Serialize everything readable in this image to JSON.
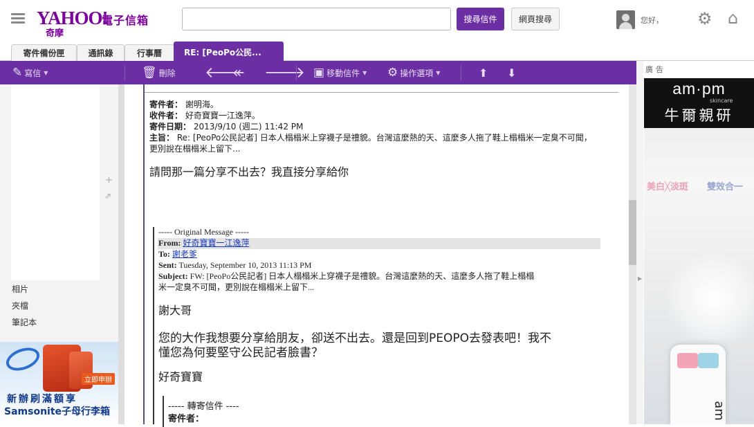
{
  "header": {
    "logo_text": "YAHOO!",
    "logo_sub": "奇摩",
    "mail_title": "電子信箱",
    "search_value": "",
    "search_mail_label": "搜尋信件",
    "search_web_label": "網頁搜尋",
    "greeting": "您好，"
  },
  "tabs": [
    {
      "label": "寄件備份匣"
    },
    {
      "label": "通訊錄"
    },
    {
      "label": "行事曆"
    },
    {
      "label": "RE: [PeoPo公民..."
    }
  ],
  "toolbar": {
    "compose": "寫信",
    "delete": "刪除",
    "move": "移動信件",
    "actions": "操作選項"
  },
  "sidebar": {
    "items": [
      {
        "label": "相片"
      },
      {
        "label": "夾檔"
      },
      {
        "label": "筆記本"
      }
    ],
    "ad": {
      "cta": "立即申辦",
      "line1": "新辦刷滿額享",
      "line2": "Samsonite子母行李箱"
    }
  },
  "message": {
    "from_label": "寄件者：",
    "from_value": "謝明海。",
    "to_label": "收件者：",
    "to_value": "好奇寶寶一江逸萍。",
    "date_label": "寄件日期：",
    "date_value": "2013/9/10 (週二) 11:42 PM",
    "subject_label": "主旨：",
    "subject_value": "Re: [PeoPo公民記者] 日本人榻榻米上穿襪子是禮貌。台灣這麼熱的天、這麼多人拖了鞋上榻榻米一定臭不可聞，更別說在榻榻米上留下...",
    "body": "請問那一篇分享不出去？我直接分享給你"
  },
  "original": {
    "divider": "----- Original Message -----",
    "from_label": "From:",
    "from_value": "好奇寶寶一江逸萍",
    "to_label": "To:",
    "to_value": "謝老爹",
    "sent_label": "Sent:",
    "sent_value": "Tuesday, September 10, 2013 11:13 PM",
    "subject_label": "Subject:",
    "subject_value_line1": "FW: [PeoPo公民記者] 日本人榻榻米上穿襪子是禮貌。台灣這麼熱的天、這麼多人拖了鞋上榻榻",
    "subject_value_line2": "米一定臭不可聞，更別說在榻榻米上留下...",
    "greeting": "謝大哥",
    "para_line1": "您的大作我想要分享給朋友，卻送不出去。還是回到PEOPO去發表吧！我不",
    "para_line2": "懂您為何要堅守公民記者臉書？",
    "signature": "好奇寶寶",
    "fwd_header": "----- 轉寄信件 ----",
    "fwd_from_label": "寄件者："
  },
  "right_ad": {
    "label": "廣告",
    "brand": "am·pm",
    "brand_sub": "skincare",
    "brand_cn": "牛爾親研",
    "tag1": "美白╳淡斑",
    "tag2": "雙效合一",
    "bottle_text": "am"
  },
  "colors": {
    "brand_purple": "#6b2fa3",
    "link_blue": "#1a3bbd"
  }
}
